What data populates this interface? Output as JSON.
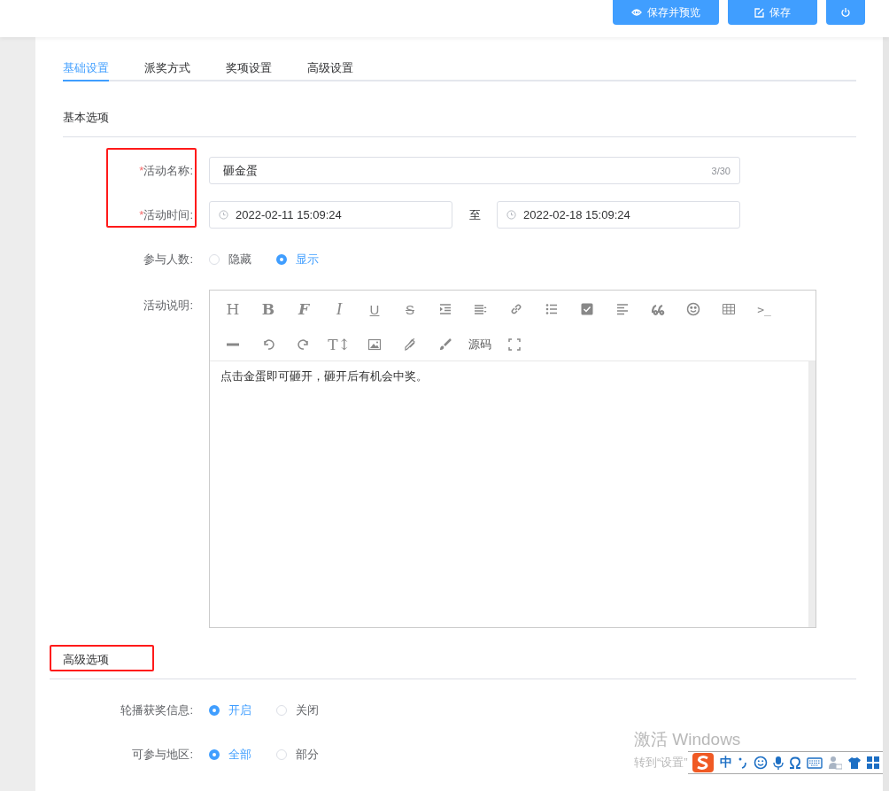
{
  "header": {
    "buttons": [
      {
        "kind": "preview",
        "label": "保存并预览"
      },
      {
        "kind": "save",
        "label": "保存"
      },
      {
        "kind": "power"
      }
    ]
  },
  "tabs": [
    {
      "label": "基础设置",
      "selected": true
    },
    {
      "label": "派奖方式",
      "selected": false
    },
    {
      "label": "奖项设置",
      "selected": false
    },
    {
      "label": "高级设置",
      "selected": false
    }
  ],
  "basic_section": {
    "title": "基本选项",
    "name_field": {
      "label": "活动名称:",
      "required_mark": "*",
      "value": "砸金蛋",
      "count": "3/30"
    },
    "time_field": {
      "label": "活动时间:",
      "required_mark": "*",
      "start": "2022-02-11 15:09:24",
      "separator": "至",
      "end": "2022-02-18 15:09:24"
    },
    "participants": {
      "label": "参与人数:",
      "options": [
        {
          "label": "隐藏",
          "selected": false
        },
        {
          "label": "显示",
          "selected": true
        }
      ]
    },
    "description": {
      "label": "活动说明:",
      "toolbar": [
        {
          "kind": "serif",
          "text": "H"
        },
        {
          "kind": "bold",
          "text": "B"
        },
        {
          "kind": "script",
          "text": "F"
        },
        {
          "kind": "italic",
          "text": "I"
        },
        {
          "kind": "underline",
          "text": "U"
        },
        {
          "kind": "strike",
          "text": "S"
        },
        {
          "kind": "icon"
        },
        {
          "kind": "icon"
        },
        {
          "kind": "icon"
        },
        {
          "kind": "icon"
        },
        {
          "kind": "icon"
        },
        {
          "kind": "icon"
        },
        {
          "kind": "icon"
        },
        {
          "kind": "icon"
        },
        {
          "kind": "icon"
        },
        {
          "kind": "mono",
          "text": ">_"
        },
        {
          "kind": "icon"
        },
        {
          "kind": "icon"
        },
        {
          "kind": "icon"
        },
        {
          "kind": "serif",
          "text": "T↕"
        },
        {
          "kind": "icon"
        },
        {
          "kind": "icon"
        },
        {
          "kind": "icon"
        },
        {
          "kind": "text",
          "text": "源码"
        },
        {
          "kind": "icon"
        }
      ],
      "content": "点击金蛋即可砸开，砸开后有机会中奖。"
    }
  },
  "advanced_section": {
    "title": "高级选项",
    "rows": [
      {
        "label": "轮播获奖信息:",
        "options": [
          {
            "label": "开启",
            "selected": true
          },
          {
            "label": "关闭",
            "selected": false
          }
        ]
      },
      {
        "label": "可参与地区:",
        "options": [
          {
            "label": "全部",
            "selected": true
          },
          {
            "label": "部分",
            "selected": false
          }
        ]
      }
    ]
  },
  "system_overlay": {
    "activation_title": "激活 Windows",
    "activation_hint": "转到“设置”",
    "ime_mode": "中"
  }
}
